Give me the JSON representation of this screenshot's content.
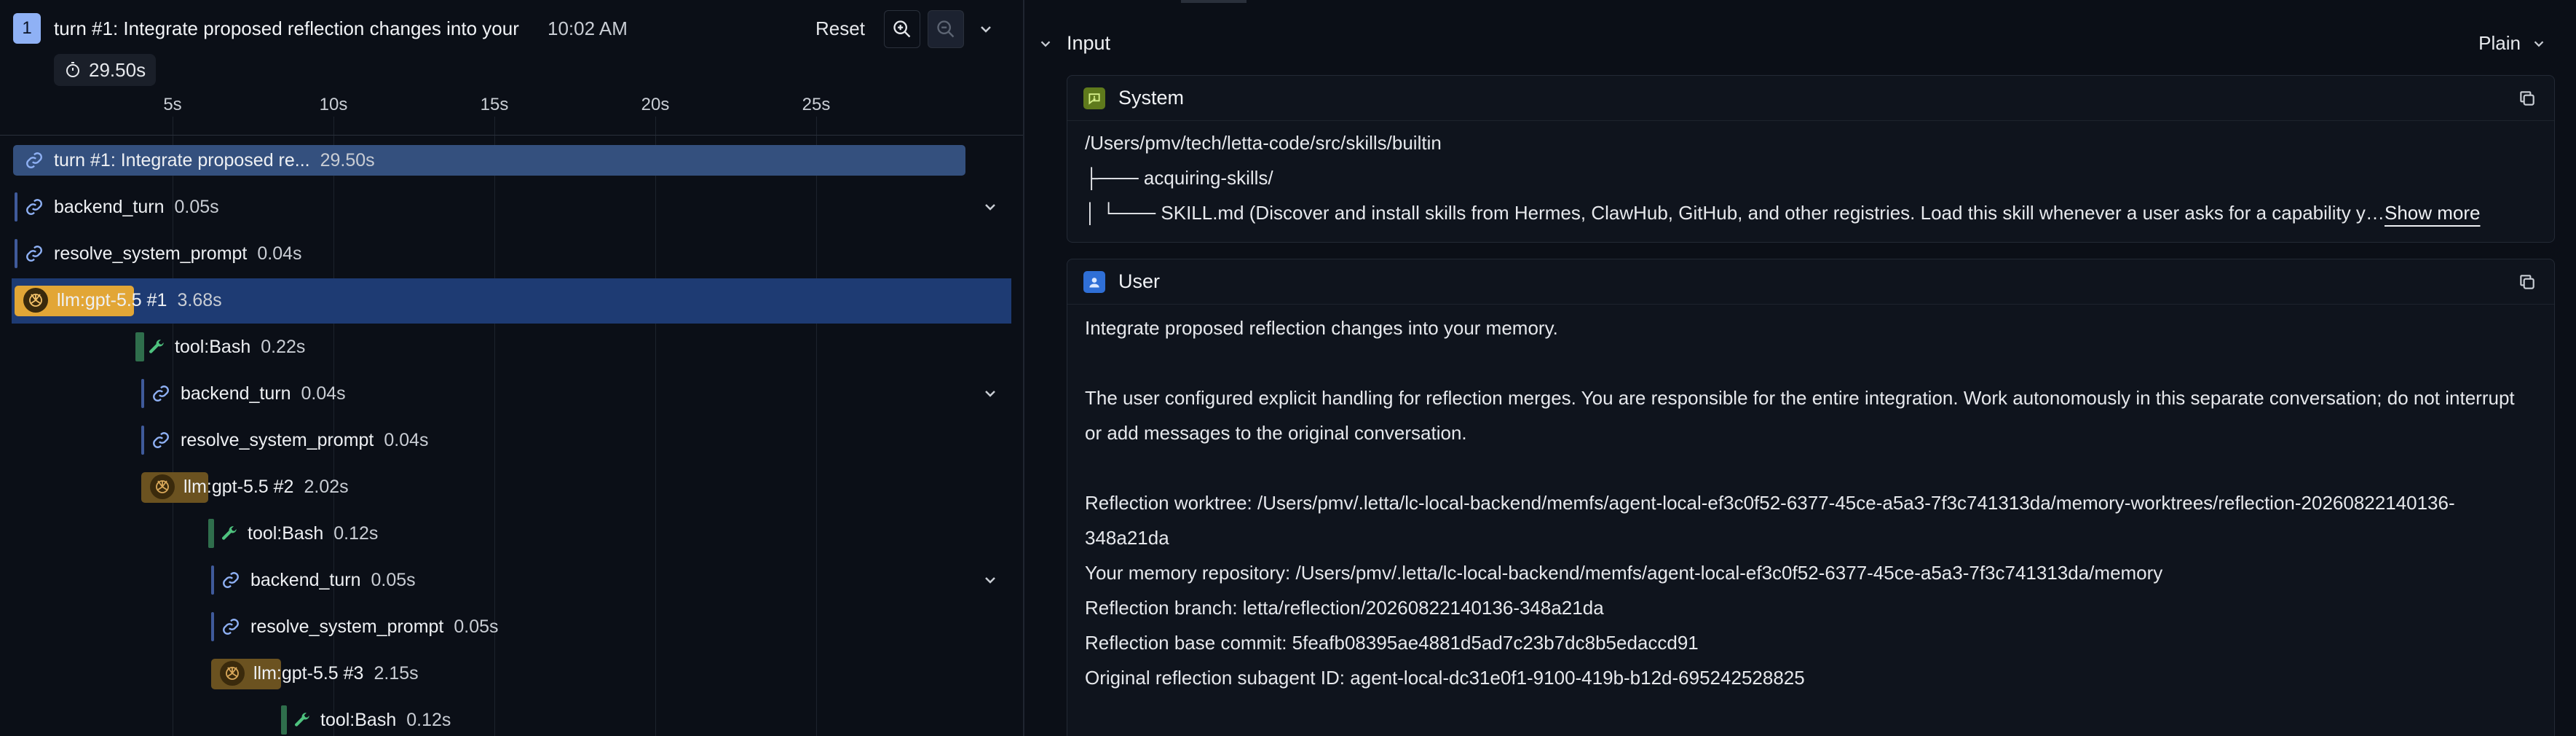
{
  "header": {
    "turn_number": "1",
    "title": "turn #1: Integrate proposed reflection changes into your",
    "time": "10:02 AM",
    "reset_label": "Reset",
    "total_duration": "29.50s"
  },
  "timeline": {
    "ticks": [
      "5s",
      "10s",
      "15s",
      "20s",
      "25s"
    ],
    "rows": [
      {
        "name": "turn #1: Integrate proposed re...",
        "duration": "29.50s",
        "type": "turn"
      },
      {
        "name": "backend_turn",
        "duration": "0.05s",
        "type": "link"
      },
      {
        "name": "resolve_system_prompt",
        "duration": "0.04s",
        "type": "link"
      },
      {
        "name": "llm:gpt-5.5 #1",
        "duration": "3.68s",
        "type": "llm"
      },
      {
        "name": "tool:Bash",
        "duration": "0.22s",
        "type": "tool"
      },
      {
        "name": "backend_turn",
        "duration": "0.04s",
        "type": "link"
      },
      {
        "name": "resolve_system_prompt",
        "duration": "0.04s",
        "type": "link"
      },
      {
        "name": "llm:gpt-5.5 #2",
        "duration": "2.02s",
        "type": "llm"
      },
      {
        "name": "tool:Bash",
        "duration": "0.12s",
        "type": "tool"
      },
      {
        "name": "backend_turn",
        "duration": "0.05s",
        "type": "link"
      },
      {
        "name": "resolve_system_prompt",
        "duration": "0.05s",
        "type": "link"
      },
      {
        "name": "llm:gpt-5.5 #3",
        "duration": "2.15s",
        "type": "llm"
      },
      {
        "name": "tool:Bash",
        "duration": "0.12s",
        "type": "tool"
      }
    ]
  },
  "input_panel": {
    "title": "Input",
    "format_label": "Plain",
    "system": {
      "label": "System",
      "lines": [
        "/Users/pmv/tech/letta-code/src/skills/builtin",
        "├─── acquiring-skills/",
        "│    └─── SKILL.md (Discover and install skills from Hermes, ClawHub, GitHub, and other registries. Load this skill whenever a user asks for a capability you don't have yet."
      ],
      "show_more": "Show more"
    },
    "user": {
      "label": "User",
      "lines": [
        "Integrate proposed reflection changes into your memory.",
        "",
        "The user configured explicit handling for reflection merges. You are responsible for the entire integration. Work autonomously in this separate conversation; do not interrupt",
        "or add messages to the original conversation.",
        "",
        "Reflection worktree: /Users/pmv/.letta/lc-local-backend/memfs/agent-local-ef3c0f52-6377-45ce-a5a3-7f3c741313da/memory-worktrees/reflection-20260822140136-",
        "348a21da",
        "Your memory repository: /Users/pmv/.letta/lc-local-backend/memfs/agent-local-ef3c0f52-6377-45ce-a5a3-7f3c741313da/memory",
        "Reflection branch: letta/reflection/20260822140136-348a21da",
        "Reflection base commit: 5feafb08395ae4881d5ad7c23b7dc8b5edaccd91",
        "Original reflection subagent ID: agent-local-dc31e0f1-9100-419b-b12d-695242528825"
      ]
    }
  },
  "colors": {
    "background": "#0b0f17",
    "turn_bar": "#34507e",
    "llm_bar": "#e2a636",
    "llm_highlight": "#1e3b73",
    "tool_line": "#2f6e4c",
    "link_line": "#3f5a9b"
  }
}
